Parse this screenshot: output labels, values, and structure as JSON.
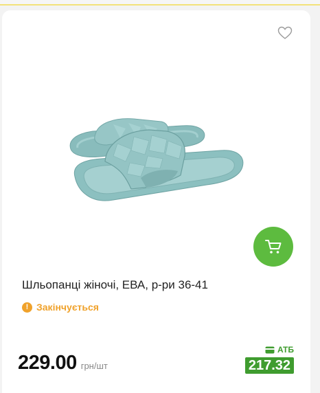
{
  "product": {
    "title": "Шльопанці жіночі, ЕВА, р-ри 36-41",
    "stock_status": "Закінчується",
    "price": "229.00",
    "price_unit": "грн/шт",
    "club_label": "АТБ",
    "club_price": "217.32"
  },
  "icons": {
    "favorite": "heart-icon",
    "cart": "cart-icon",
    "stock": "exclamation-icon",
    "club": "card-icon"
  },
  "colors": {
    "accent_green": "#5dbb3f",
    "club_green": "#3f9c2f",
    "warning_orange": "#f0a22b"
  }
}
